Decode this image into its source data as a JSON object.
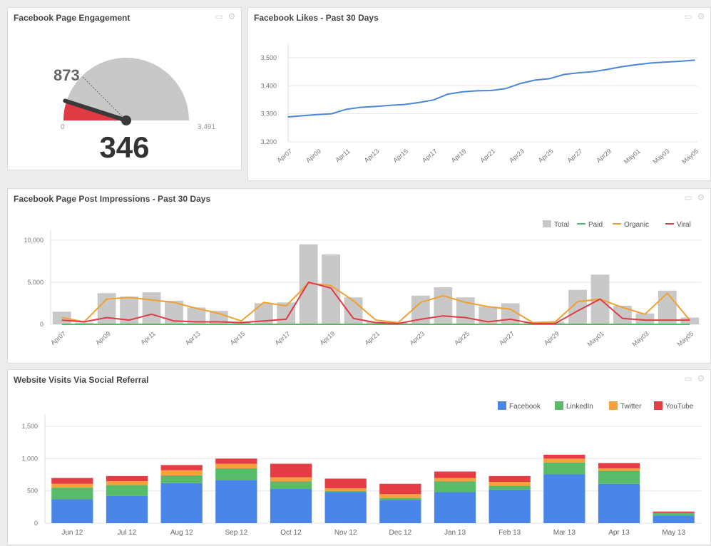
{
  "panels": {
    "engagement": {
      "title": "Facebook Page Engagement"
    },
    "likes": {
      "title": "Facebook Likes - Past 30 Days"
    },
    "impressions": {
      "title": "Facebook Page Post Impressions - Past 30 Days"
    },
    "visits": {
      "title": "Website Visits Via Social Referral"
    }
  },
  "icons": {
    "comment": "comment-icon",
    "settings": "gear-icon"
  },
  "gauge": {
    "value": 346,
    "value_label": "346",
    "target": 873,
    "target_label": "873",
    "min": 0,
    "min_label": "0",
    "max": 3491,
    "max_label": "3,491",
    "colors": {
      "fill": "#e03a45",
      "track": "#c8c8c8",
      "needle": "#3a3a3a"
    }
  },
  "chart_data": [
    {
      "type": "line",
      "id": "likes",
      "x": [
        "Apr07",
        "Apr08",
        "Apr09",
        "Apr10",
        "Apr11",
        "Apr12",
        "Apr13",
        "Apr14",
        "Apr15",
        "Apr16",
        "Apr17",
        "Apr18",
        "Apr19",
        "Apr20",
        "Apr21",
        "Apr22",
        "Apr23",
        "Apr24",
        "Apr25",
        "Apr26",
        "Apr27",
        "Apr28",
        "Apr29",
        "Apr30",
        "May01",
        "May02",
        "May03",
        "May04",
        "May05"
      ],
      "tick_labels": [
        "Apr07",
        "Apr09",
        "Apr11",
        "Apr13",
        "Apr15",
        "Apr17",
        "Apr19",
        "Apr21",
        "Apr23",
        "Apr25",
        "Apr27",
        "Apr29",
        "May01",
        "May03",
        "May05"
      ],
      "y_ticks": [
        "3,200",
        "3,300",
        "3,400",
        "3,500"
      ],
      "series": [
        {
          "values": [
            3289,
            3293,
            3297,
            3300,
            3316,
            3323,
            3326,
            3330,
            3333,
            3340,
            3349,
            3370,
            3378,
            3382,
            3383,
            3390,
            3408,
            3420,
            3425,
            3440,
            3446,
            3450,
            3458,
            3468,
            3475,
            3481,
            3484,
            3487,
            3491
          ],
          "color": "#4a86d8"
        }
      ],
      "ylim": [
        3200,
        3520
      ]
    },
    {
      "type": "bar",
      "id": "impressions",
      "x": [
        "Apr07",
        "Apr08",
        "Apr09",
        "Apr10",
        "Apr11",
        "Apr12",
        "Apr13",
        "Apr14",
        "Apr15",
        "Apr16",
        "Apr17",
        "Apr18",
        "Apr19",
        "Apr20",
        "Apr21",
        "Apr22",
        "Apr23",
        "Apr24",
        "Apr25",
        "Apr26",
        "Apr27",
        "Apr28",
        "Apr29",
        "Apr30",
        "May01",
        "May02",
        "May03",
        "May04",
        "May05"
      ],
      "tick_labels": [
        "Apr07",
        "Apr09",
        "Apr11",
        "Apr13",
        "Apr15",
        "Apr17",
        "Apr19",
        "Apr21",
        "Apr23",
        "Apr25",
        "Apr27",
        "Apr29",
        "May01",
        "May03",
        "May05"
      ],
      "y_ticks": [
        "0",
        "5,000",
        "10,000"
      ],
      "legend": [
        "Total",
        "Paid",
        "Organic",
        "Viral"
      ],
      "series": [
        {
          "name": "Total",
          "kind": "bar",
          "color": "#c8c8c8",
          "values": [
            1500,
            200,
            3700,
            3300,
            3800,
            2800,
            2000,
            1600,
            300,
            2500,
            2600,
            9500,
            8300,
            3200,
            300,
            200,
            3400,
            4400,
            3200,
            2100,
            2500,
            200,
            300,
            4100,
            5900,
            2200,
            1300,
            4000,
            800
          ]
        },
        {
          "name": "Paid",
          "kind": "line",
          "color": "#5cb85c",
          "values": [
            0,
            0,
            0,
            0,
            0,
            0,
            0,
            0,
            0,
            0,
            0,
            0,
            0,
            0,
            0,
            0,
            0,
            0,
            0,
            0,
            0,
            0,
            0,
            0,
            0,
            0,
            0,
            0,
            0
          ]
        },
        {
          "name": "Organic",
          "kind": "line",
          "color": "#f0a030",
          "values": [
            800,
            300,
            3000,
            3200,
            2900,
            2600,
            1900,
            1300,
            400,
            2600,
            2200,
            4900,
            4600,
            2800,
            500,
            200,
            2600,
            3400,
            2600,
            2100,
            1800,
            200,
            300,
            2700,
            3000,
            2000,
            1200,
            3700,
            500
          ]
        },
        {
          "name": "Viral",
          "kind": "line",
          "color": "#e03a45",
          "values": [
            500,
            300,
            800,
            500,
            1200,
            400,
            300,
            300,
            200,
            400,
            600,
            5000,
            4300,
            700,
            200,
            100,
            600,
            1000,
            800,
            300,
            600,
            100,
            100,
            1600,
            3000,
            700,
            500,
            500,
            500
          ]
        }
      ],
      "ylim": [
        0,
        10500
      ]
    },
    {
      "type": "bar",
      "id": "visits",
      "stacked": true,
      "categories": [
        "Jun 12",
        "Jul 12",
        "Aug 12",
        "Sep 12",
        "Oct 12",
        "Nov 12",
        "Dec 12",
        "Jan 13",
        "Feb 13",
        "Mar 13",
        "Apr 13",
        "May 13"
      ],
      "y_ticks": [
        "0",
        "500",
        "1,000",
        "1,500"
      ],
      "legend": [
        "Facebook",
        "LinkedIn",
        "Twitter",
        "YouTube"
      ],
      "series": [
        {
          "name": "Facebook",
          "color": "#4a86e8",
          "values": [
            370,
            420,
            620,
            670,
            530,
            480,
            360,
            480,
            520,
            760,
            610,
            120
          ]
        },
        {
          "name": "LinkedIn",
          "color": "#57bb6a",
          "values": [
            180,
            170,
            120,
            180,
            120,
            20,
            30,
            170,
            60,
            180,
            200,
            40
          ]
        },
        {
          "name": "Twitter",
          "color": "#f6a13a",
          "values": [
            60,
            60,
            80,
            70,
            60,
            40,
            60,
            50,
            60,
            60,
            40,
            0
          ]
        },
        {
          "name": "YouTube",
          "color": "#e53c46",
          "values": [
            90,
            80,
            80,
            80,
            210,
            150,
            160,
            100,
            90,
            60,
            80,
            20
          ]
        }
      ],
      "ylim": [
        0,
        1600
      ]
    }
  ]
}
